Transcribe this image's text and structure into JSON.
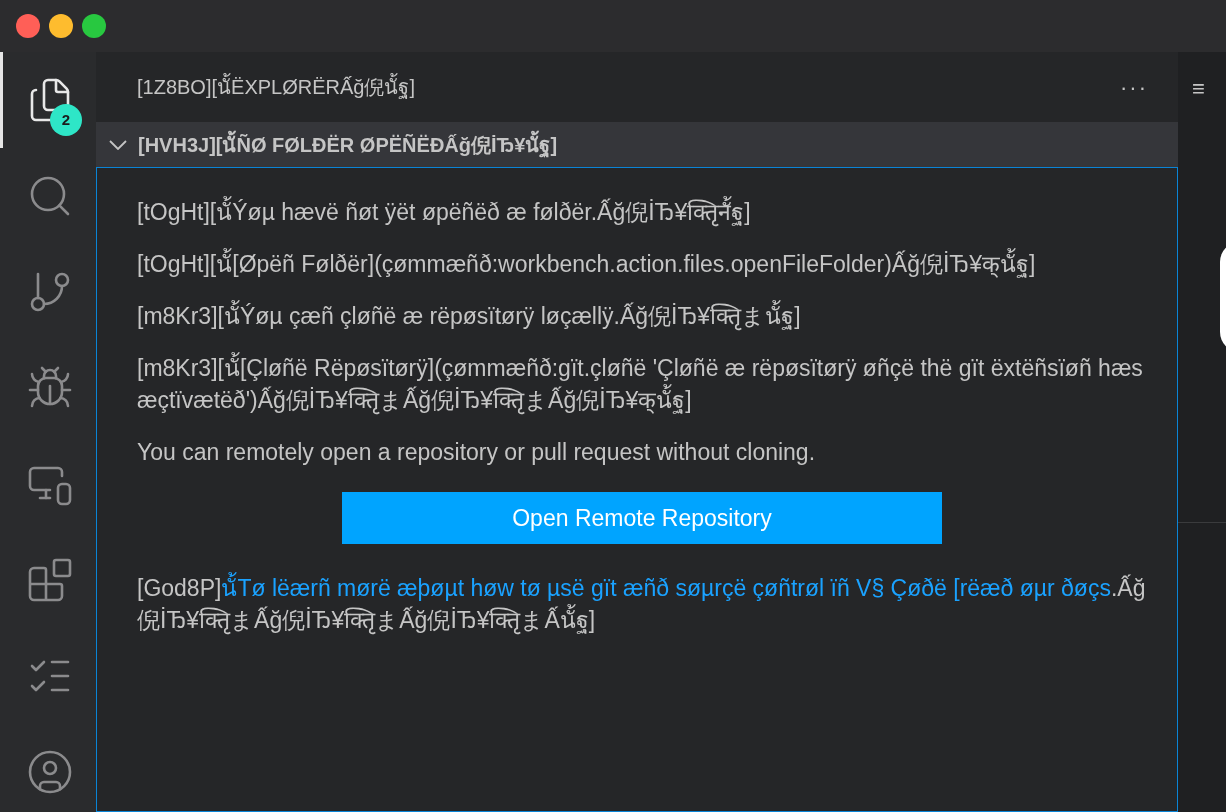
{
  "window": {
    "controls": [
      {
        "color": "#ff5f57"
      },
      {
        "color": "#febc2e"
      },
      {
        "color": "#28c840"
      }
    ]
  },
  "activity_bar": [
    {
      "kind": "files",
      "selected": true,
      "badge": "2"
    },
    {
      "kind": "search",
      "selected": false
    },
    {
      "kind": "source-control",
      "selected": false
    },
    {
      "kind": "run-debug",
      "selected": false
    },
    {
      "kind": "remote",
      "selected": false
    },
    {
      "kind": "extensions",
      "selected": false
    },
    {
      "kind": "testing",
      "selected": false
    },
    {
      "kind": "account",
      "selected": false
    }
  ],
  "sidebar": {
    "title": "[1Z8BO][นั้ЁXPLØRЁRẤğ倪นั้ฐ]",
    "more": "···",
    "section": {
      "title": "[HVH3J][นั้ÑØ FØLÐЁR ØPЁÑЁÐẤğ倪İЂ¥นั้ฐ]",
      "expanded": true
    },
    "paragraphs": [
      "[tOgHt][นั้Ýøµ hævë ñøt ÿët øpëñëð æ følðër.Ấğ倪İЂ¥क्तिृनั้ฐ]",
      "[tOgHt][นั้[Øpëñ Følðër](çømmæñð:workbench.action.files.openFileFolder)Ấğ倪İЂ¥क्นั้ฐ]",
      "[m8Kr3][นั้Ýøµ çæñ çløñë æ rëpøsïtørÿ løçællÿ.Ấğ倪İЂ¥क्तिृまนั้ฐ]",
      "[m8Kr3][นั้[Çløñë Rëpøsïtørÿ](çømmæñð:gït.çløñë 'Çløñë æ rëpøsïtørÿ øñçë thë gït ëxtëñsïøñ hæs æçtïvætëð')Ấğ倪İЂ¥क्तिृまẤğ倪İЂ¥क्तिृまẤğ倪İЂ¥क्นั้ฐ]",
      "You can remotely open a repository or pull request without cloning."
    ],
    "button": "Open Remote Repository",
    "footer": {
      "prefix": "[God8P]",
      "link": "นั้Tø lëærñ mørë æþøµt høw tø µsë gït æñð søµrçë çøñtrøl ïñ V§ Çøðë [rëæð øµr ðøçs",
      "suffix": ".Ấğ倪İЂ¥क्तिृまẤğ倪İЂ¥क्तिृまẤğ倪İЂ¥क्तिृまẤนั้ฐ]"
    }
  },
  "editor": {
    "menu": "≡"
  }
}
